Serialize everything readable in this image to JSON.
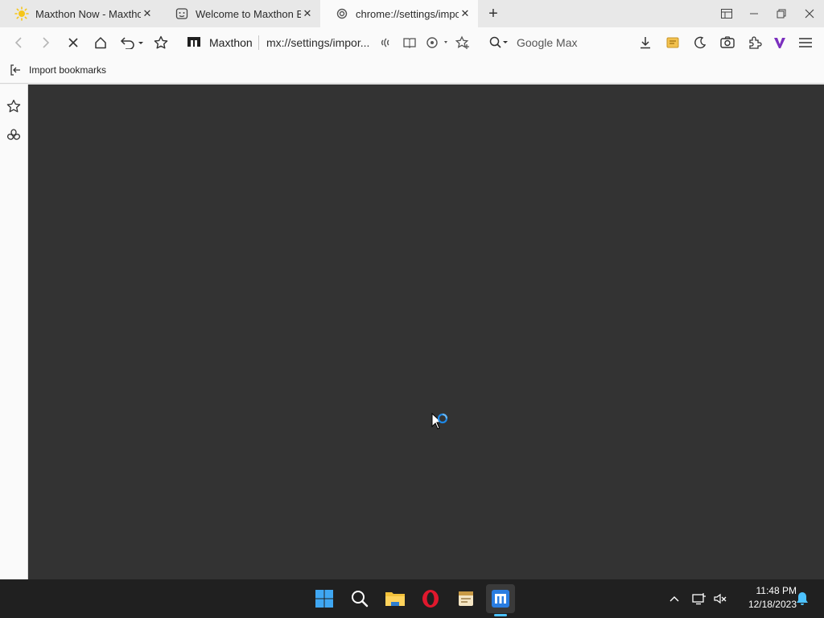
{
  "tabs": [
    {
      "title": "Maxthon Now - Maxtho",
      "icon": "sun-icon",
      "active": false
    },
    {
      "title": "Welcome to Maxthon Br",
      "icon": "robot-face-icon",
      "active": false
    },
    {
      "title": "chrome://settings/impor",
      "icon": "settings-swirl-icon",
      "active": true
    }
  ],
  "window_controls": [
    "layout-icon",
    "minimize-icon",
    "restore-icon",
    "close-icon"
  ],
  "toolbar": {
    "brand": "Maxthon",
    "url": "mx://settings/impor...",
    "search_placeholder": "Google Max"
  },
  "bookmarks_bar": {
    "import_label": "Import bookmarks"
  },
  "taskbar": {
    "apps": [
      "windows-start-icon",
      "search-icon",
      "file-explorer-icon",
      "opera-icon",
      "notes-app-icon",
      "maxthon-icon"
    ],
    "time": "11:48 PM",
    "date": "12/18/2023"
  },
  "colors": {
    "content_bg": "#333333",
    "taskbar_bg": "#202020",
    "accent": "#4cc2ff",
    "maxthon_brand": "#7b2fbe"
  }
}
